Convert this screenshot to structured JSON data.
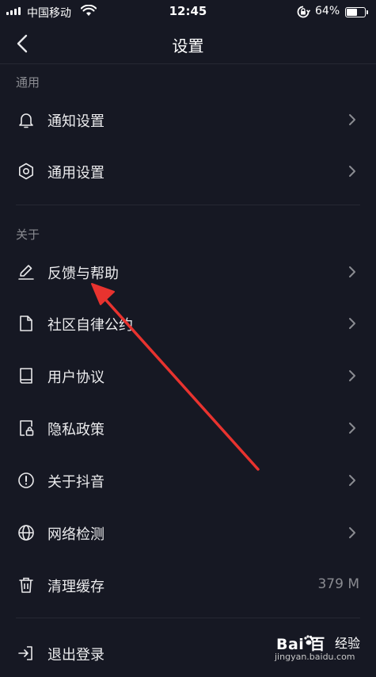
{
  "status_bar": {
    "carrier": "中国移动",
    "time": "12:45",
    "battery_percent": "64%",
    "battery_level": 0.64,
    "icons": [
      "signal-icon",
      "wifi-icon",
      "rotation-lock-icon",
      "battery-icon"
    ]
  },
  "nav": {
    "title": "设置",
    "back_icon": "chevron-left-icon"
  },
  "sections": {
    "general": {
      "label": "通用",
      "items": [
        {
          "label": "通知设置",
          "icon": "bell-icon"
        },
        {
          "label": "通用设置",
          "icon": "gear-icon"
        }
      ]
    },
    "about": {
      "label": "关于",
      "items": [
        {
          "label": "反馈与帮助",
          "icon": "pencil-icon"
        },
        {
          "label": "社区自律公约",
          "icon": "document-icon"
        },
        {
          "label": "用户协议",
          "icon": "book-icon"
        },
        {
          "label": "隐私政策",
          "icon": "lock-document-icon"
        },
        {
          "label": "关于抖音",
          "icon": "info-icon"
        },
        {
          "label": "网络检测",
          "icon": "globe-icon"
        },
        {
          "label": "清理缓存",
          "icon": "trash-icon",
          "value": "379 M"
        }
      ]
    },
    "logout": {
      "label": "退出登录",
      "icon": "logout-icon"
    }
  },
  "annotation": {
    "color": "#e8332f",
    "points_to": "反馈与帮助"
  },
  "watermark": {
    "brand": "Bai 百",
    "jingyan": "经验",
    "url": "jingyan.baidu.com"
  },
  "colors": {
    "background": "#161823",
    "text": "#ececee",
    "secondary_text": "#8a8b91",
    "divider": "#262833",
    "arrow": "#e8332f"
  }
}
